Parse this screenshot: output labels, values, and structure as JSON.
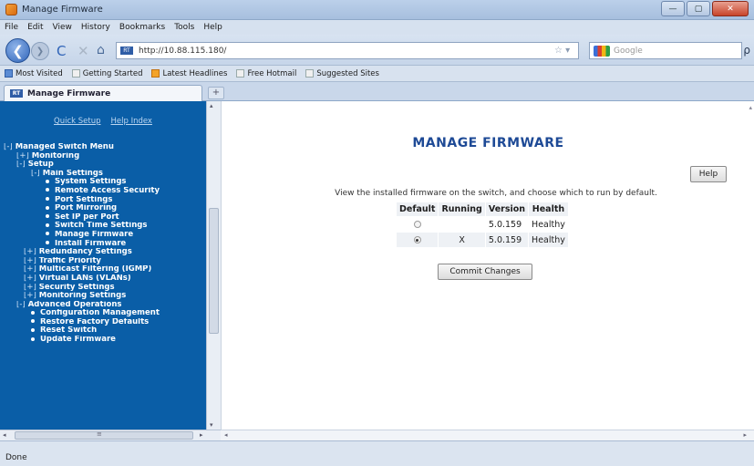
{
  "window": {
    "title": "Manage Firmware",
    "controls": {
      "minimize": "—",
      "maximize": "▢",
      "close": "✕"
    }
  },
  "menubar": [
    "File",
    "Edit",
    "View",
    "History",
    "Bookmarks",
    "Tools",
    "Help"
  ],
  "nav": {
    "back": "❮",
    "forward": "❯",
    "reload": "C",
    "stop": "✕",
    "home": "⌂",
    "url": "http://10.88.115.180/",
    "site_label": "RT",
    "star": "☆ ▾",
    "search_placeholder": "Google",
    "search_glass": "ρ"
  },
  "bookmarks": [
    "Most Visited",
    "Getting Started",
    "Latest Headlines",
    "Free Hotmail",
    "Suggested Sites"
  ],
  "tab": {
    "label": "Manage Firmware",
    "icon_label": "RT",
    "new_tab": "+"
  },
  "left_nav": {
    "quicklinks": [
      "Quick Setup",
      "Help Index"
    ],
    "items": [
      {
        "text": "Managed Switch Menu",
        "level": "l0",
        "toggle": "[-]"
      },
      {
        "text": "Monitoring",
        "level": "l1",
        "toggle": "[+]"
      },
      {
        "text": "Setup",
        "level": "l1",
        "toggle": "[-]"
      },
      {
        "text": "Main Settings",
        "level": "l2",
        "toggle": "[-]"
      },
      {
        "text": "System Settings",
        "level": "l3",
        "bullet": true
      },
      {
        "text": "Remote Access Security",
        "level": "l3",
        "bullet": true
      },
      {
        "text": "Port Settings",
        "level": "l3",
        "bullet": true
      },
      {
        "text": "Port Mirroring",
        "level": "l3",
        "bullet": true
      },
      {
        "text": "Set IP per Port",
        "level": "l3",
        "bullet": true
      },
      {
        "text": "Switch Time Settings",
        "level": "l3",
        "bullet": true
      },
      {
        "text": "Manage Firmware",
        "level": "l3",
        "bullet": true
      },
      {
        "text": "Install Firmware",
        "level": "l3",
        "bullet": true
      },
      {
        "text": "Redundancy Settings",
        "level": "l1b",
        "toggle": "[+]"
      },
      {
        "text": "Traffic Priority",
        "level": "l1b",
        "toggle": "[+]"
      },
      {
        "text": "Multicast Filtering (IGMP)",
        "level": "l1b",
        "toggle": "[+]"
      },
      {
        "text": "Virtual LANs (VLANs)",
        "level": "l1b",
        "toggle": "[+]"
      },
      {
        "text": "Security Settings",
        "level": "l1b",
        "toggle": "[+]"
      },
      {
        "text": "Monitoring Settings",
        "level": "l1b",
        "toggle": "[+]"
      },
      {
        "text": "Advanced Operations",
        "level": "l1",
        "toggle": "[-]"
      },
      {
        "text": "Configuration Management",
        "level": "l2",
        "bullet": true
      },
      {
        "text": "Restore Factory Defaults",
        "level": "l2",
        "bullet": true
      },
      {
        "text": "Reset Switch",
        "level": "l2",
        "bullet": true
      },
      {
        "text": "Update Firmware",
        "level": "l2",
        "bullet": true
      }
    ]
  },
  "main": {
    "title": "MANAGE FIRMWARE",
    "help_label": "Help",
    "description": "View the installed firmware on the switch, and choose which to run by default.",
    "table": {
      "headers": [
        "Default",
        "Running",
        "Version",
        "Health"
      ],
      "rows": [
        {
          "default_selected": false,
          "running": "",
          "version": "5.0.159",
          "health": "Healthy"
        },
        {
          "default_selected": true,
          "running": "X",
          "version": "5.0.159",
          "health": "Healthy"
        }
      ]
    },
    "commit_label": "Commit Changes"
  },
  "scroll": {
    "left": "◂",
    "right": "▸",
    "up": "▴",
    "down": "▾",
    "grip": "≡"
  },
  "status": {
    "text": "Done"
  }
}
